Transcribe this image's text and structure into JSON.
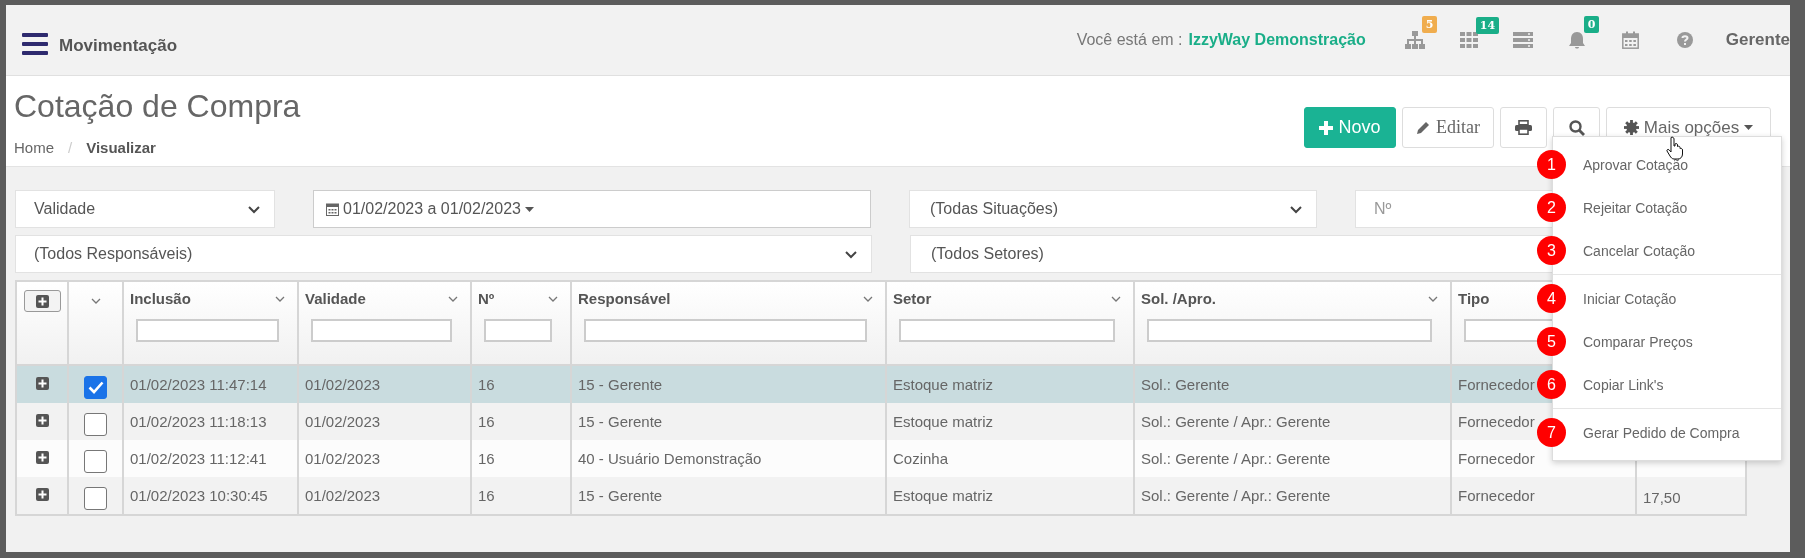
{
  "topbar": {
    "section": "Movimentação",
    "location_label": "Você está em :",
    "location": "IzzyWay Demonstração",
    "user": "Gerente",
    "icons": [
      {
        "kind": "sitemap",
        "badge": "5",
        "color": "#f0ad4e"
      },
      {
        "kind": "grid",
        "badge": "14",
        "color": "#1aae88"
      },
      {
        "kind": "server"
      },
      {
        "kind": "bell",
        "badge": "0",
        "color": "#1aae88"
      },
      {
        "kind": "calendar"
      },
      {
        "kind": "help"
      }
    ]
  },
  "page": {
    "title": "Cotação de Compra",
    "breadcrumb_separator": "/",
    "breadcrumb": [
      {
        "label": "Home",
        "current": false
      },
      {
        "label": "Visualizar",
        "current": true
      }
    ]
  },
  "toolbar": {
    "new": "Novo",
    "edit": "Editar",
    "more": "Mais opções"
  },
  "filters": {
    "date_field": "Validade",
    "date_range": "01/02/2023 a 01/02/2023",
    "situation": "(Todas Situações)",
    "number_placeholder": "Nº",
    "responsible": "(Todos Responsáveis)",
    "sector": "(Todos Setores)"
  },
  "table": {
    "columns": [
      "Inclusão",
      "Validade",
      "Nº",
      "Responsável",
      "Setor",
      "Sol. /Apro.",
      "Tipo"
    ],
    "rows": [
      {
        "selected": true,
        "cells": [
          "01/02/2023 11:47:14",
          "01/02/2023",
          "16",
          "15 - Gerente",
          "Estoque matriz",
          "Sol.: Gerente",
          "Fornecedor"
        ]
      },
      {
        "selected": false,
        "cells": [
          "01/02/2023 11:18:13",
          "01/02/2023",
          "16",
          "15 - Gerente",
          "Estoque matriz",
          "Sol.: Gerente / Apr.: Gerente",
          "Fornecedor"
        ]
      },
      {
        "selected": false,
        "cells": [
          "01/02/2023 11:12:41",
          "01/02/2023",
          "16",
          "40 - Usuário Demonstração",
          "Cozinha",
          "Sol.: Gerente / Apr.: Gerente",
          "Fornecedor"
        ]
      },
      {
        "selected": false,
        "cells": [
          "01/02/2023 10:30:45",
          "01/02/2023",
          "16",
          "15 - Gerente",
          "Estoque matriz",
          "Sol.: Gerente / Apr.: Gerente",
          "Fornecedor"
        ],
        "column_9": "17,50"
      }
    ]
  },
  "menu": {
    "groups": [
      [
        {
          "marker": "1",
          "label": "Aprovar Cotação"
        },
        {
          "marker": "2",
          "label": "Rejeitar Cotação"
        },
        {
          "marker": "3",
          "label": "Cancelar Cotação"
        }
      ],
      [
        {
          "marker": "4",
          "label": "Iniciar Cotação"
        },
        {
          "marker": "5",
          "label": "Comparar Preços"
        },
        {
          "marker": "6",
          "label": "Copiar Link's"
        }
      ],
      [
        {
          "marker": "7",
          "label": "Gerar Pedido de Compra"
        }
      ]
    ]
  }
}
